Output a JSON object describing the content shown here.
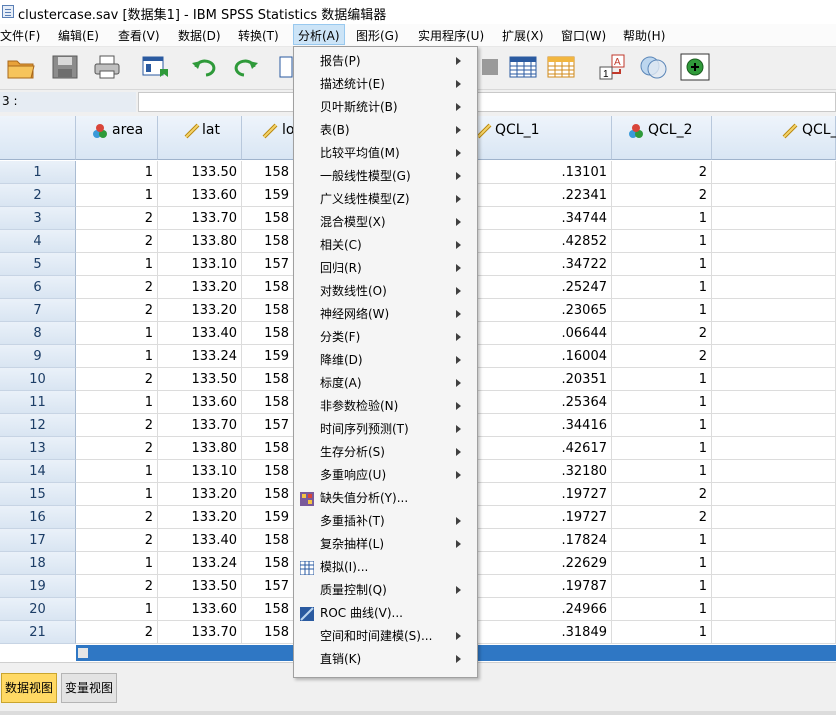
{
  "window": {
    "title": "clustercase.sav [数据集1] - IBM SPSS Statistics 数据编辑器"
  },
  "menubar": [
    {
      "label": "文件(F)"
    },
    {
      "label": "编辑(E)"
    },
    {
      "label": "查看(V)"
    },
    {
      "label": "数据(D)"
    },
    {
      "label": "转换(T)"
    },
    {
      "label": "分析(A)"
    },
    {
      "label": "图形(G)"
    },
    {
      "label": "实用程序(U)"
    },
    {
      "label": "扩展(X)"
    },
    {
      "label": "窗口(W)"
    },
    {
      "label": "帮助(H)"
    }
  ],
  "cellref": {
    "ref": "3 :",
    "value": ""
  },
  "columns": [
    {
      "name": "area",
      "type": "nominal"
    },
    {
      "name": "lat",
      "type": "scale"
    },
    {
      "name": "lo",
      "type": "scale"
    },
    {
      "name": "QCL_1",
      "type": "scale"
    },
    {
      "name": "QCL_2",
      "type": "nominal"
    },
    {
      "name": "QCL_",
      "type": "scale"
    }
  ],
  "rows": [
    {
      "n": "1",
      "area": "1",
      "lat": "133.50",
      "lo": "158",
      "qcl1": ".13101",
      "qcl2": "2"
    },
    {
      "n": "2",
      "area": "1",
      "lat": "133.60",
      "lo": "159",
      "qcl1": ".22341",
      "qcl2": "2"
    },
    {
      "n": "3",
      "area": "2",
      "lat": "133.70",
      "lo": "158",
      "qcl1": ".34744",
      "qcl2": "1"
    },
    {
      "n": "4",
      "area": "2",
      "lat": "133.80",
      "lo": "158",
      "qcl1": ".42852",
      "qcl2": "1"
    },
    {
      "n": "5",
      "area": "1",
      "lat": "133.10",
      "lo": "157",
      "qcl1": ".34722",
      "qcl2": "1"
    },
    {
      "n": "6",
      "area": "2",
      "lat": "133.20",
      "lo": "158",
      "qcl1": ".25247",
      "qcl2": "1"
    },
    {
      "n": "7",
      "area": "2",
      "lat": "133.20",
      "lo": "158",
      "qcl1": ".23065",
      "qcl2": "1"
    },
    {
      "n": "8",
      "area": "1",
      "lat": "133.40",
      "lo": "158",
      "qcl1": ".06644",
      "qcl2": "2"
    },
    {
      "n": "9",
      "area": "1",
      "lat": "133.24",
      "lo": "159",
      "qcl1": ".16004",
      "qcl2": "2"
    },
    {
      "n": "10",
      "area": "2",
      "lat": "133.50",
      "lo": "158",
      "qcl1": ".20351",
      "qcl2": "1"
    },
    {
      "n": "11",
      "area": "1",
      "lat": "133.60",
      "lo": "158",
      "qcl1": ".25364",
      "qcl2": "1"
    },
    {
      "n": "12",
      "area": "2",
      "lat": "133.70",
      "lo": "157",
      "qcl1": ".34416",
      "qcl2": "1"
    },
    {
      "n": "13",
      "area": "2",
      "lat": "133.80",
      "lo": "158",
      "qcl1": ".42617",
      "qcl2": "1"
    },
    {
      "n": "14",
      "area": "1",
      "lat": "133.10",
      "lo": "158",
      "qcl1": ".32180",
      "qcl2": "1"
    },
    {
      "n": "15",
      "area": "1",
      "lat": "133.20",
      "lo": "158",
      "qcl1": ".19727",
      "qcl2": "2"
    },
    {
      "n": "16",
      "area": "2",
      "lat": "133.20",
      "lo": "159",
      "qcl1": ".19727",
      "qcl2": "2"
    },
    {
      "n": "17",
      "area": "2",
      "lat": "133.40",
      "lo": "158",
      "qcl1": ".17824",
      "qcl2": "1"
    },
    {
      "n": "18",
      "area": "1",
      "lat": "133.24",
      "lo": "158",
      "qcl1": ".22629",
      "qcl2": "1"
    },
    {
      "n": "19",
      "area": "2",
      "lat": "133.50",
      "lo": "157",
      "qcl1": ".19787",
      "qcl2": "1"
    },
    {
      "n": "20",
      "area": "1",
      "lat": "133.60",
      "lo": "158",
      "qcl1": ".24966",
      "qcl2": "1"
    },
    {
      "n": "21",
      "area": "2",
      "lat": "133.70",
      "lo": "158",
      "qcl1": ".31849",
      "qcl2": "1"
    }
  ],
  "tabs": [
    {
      "label": "数据视图",
      "active": true
    },
    {
      "label": "变量视图",
      "active": false
    }
  ],
  "analyze_menu": [
    {
      "label": "报告(P)",
      "submenu": true
    },
    {
      "label": "描述统计(E)",
      "submenu": true
    },
    {
      "label": "贝叶斯统计(B)",
      "submenu": true
    },
    {
      "label": "表(B)",
      "submenu": true
    },
    {
      "label": "比较平均值(M)",
      "submenu": true
    },
    {
      "label": "一般线性模型(G)",
      "submenu": true
    },
    {
      "label": "广义线性模型(Z)",
      "submenu": true
    },
    {
      "label": "混合模型(X)",
      "submenu": true
    },
    {
      "label": "相关(C)",
      "submenu": true
    },
    {
      "label": "回归(R)",
      "submenu": true
    },
    {
      "label": "对数线性(O)",
      "submenu": true
    },
    {
      "label": "神经网络(W)",
      "submenu": true
    },
    {
      "label": "分类(F)",
      "submenu": true
    },
    {
      "label": "降维(D)",
      "submenu": true
    },
    {
      "label": "标度(A)",
      "submenu": true
    },
    {
      "label": "非参数检验(N)",
      "submenu": true
    },
    {
      "label": "时间序列预测(T)",
      "submenu": true
    },
    {
      "label": "生存分析(S)",
      "submenu": true
    },
    {
      "label": "多重响应(U)",
      "submenu": true
    },
    {
      "label": "缺失值分析(Y)...",
      "submenu": false,
      "icon": "missing-value-icon"
    },
    {
      "label": "多重插补(T)",
      "submenu": true
    },
    {
      "label": "复杂抽样(L)",
      "submenu": true
    },
    {
      "label": "模拟(I)...",
      "submenu": false,
      "icon": "simulation-icon"
    },
    {
      "label": "质量控制(Q)",
      "submenu": true
    },
    {
      "label": "ROC 曲线(V)...",
      "submenu": false,
      "icon": "roc-curve-icon"
    },
    {
      "label": "空间和时间建模(S)...",
      "submenu": true
    },
    {
      "label": "直销(K)",
      "submenu": true
    }
  ],
  "colors": {
    "accent": "#2f77c4",
    "menu_highlight": "#cce4f7",
    "active_tab": "#ffd964",
    "row_header": "#1c3d66"
  }
}
